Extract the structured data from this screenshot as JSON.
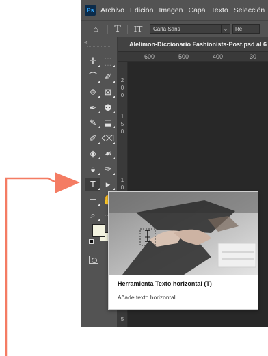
{
  "app": {
    "logo": "Ps"
  },
  "menubar": {
    "items": [
      {
        "label": "Archivo"
      },
      {
        "label": "Edición"
      },
      {
        "label": "Imagen"
      },
      {
        "label": "Capa"
      },
      {
        "label": "Texto"
      },
      {
        "label": "Selección"
      }
    ]
  },
  "options_bar": {
    "home_icon": "home-icon",
    "tool_icon": "T",
    "orientation_icon": "IT",
    "font_family": "Carla Sans",
    "font_style": "Re"
  },
  "document": {
    "tab_title": "Alelimon-Diccionario Fashionista-Post.psd al 6"
  },
  "rulers": {
    "horizontal": [
      "600",
      "500",
      "400",
      "30"
    ],
    "vertical": [
      "2",
      "0",
      "0",
      "1",
      "5",
      "0",
      "1",
      "0",
      "0",
      "5"
    ]
  },
  "toolbox": {
    "collapse": "«",
    "tools": [
      {
        "icon": "move-icon",
        "glyph": "✛"
      },
      {
        "icon": "marquee-icon",
        "glyph": "⬚"
      },
      {
        "icon": "lasso-icon",
        "glyph": "⌒"
      },
      {
        "icon": "quick-selection-icon",
        "glyph": "✐"
      },
      {
        "icon": "crop-icon",
        "glyph": "⯑"
      },
      {
        "icon": "frame-icon",
        "glyph": "⊠"
      },
      {
        "icon": "eyedropper-icon",
        "glyph": "✒"
      },
      {
        "icon": "spot-healing-icon",
        "glyph": "⚉"
      },
      {
        "icon": "brush-icon",
        "glyph": "✎"
      },
      {
        "icon": "clone-stamp-icon",
        "glyph": "⬓"
      },
      {
        "icon": "history-brush-icon",
        "glyph": "✐"
      },
      {
        "icon": "eraser-icon",
        "glyph": "⌫"
      },
      {
        "icon": "paint-bucket-icon",
        "glyph": "◈"
      },
      {
        "icon": "blur-icon",
        "glyph": "☙"
      },
      {
        "icon": "dodge-icon",
        "glyph": "◒"
      },
      {
        "icon": "pen-icon",
        "glyph": "✑"
      },
      {
        "icon": "type-icon",
        "glyph": "T"
      },
      {
        "icon": "path-selection-icon",
        "glyph": "▸"
      },
      {
        "icon": "rectangle-icon",
        "glyph": "▭"
      },
      {
        "icon": "hand-icon",
        "glyph": "✋"
      },
      {
        "icon": "zoom-icon",
        "glyph": "⌕"
      },
      {
        "icon": "more-tools-icon",
        "glyph": "⋯"
      }
    ],
    "foreground_color": "#f3f3e0",
    "background_color": "#f3f3e0"
  },
  "tooltip": {
    "title": "Herramienta Texto horizontal (T)",
    "description": "Añade texto horizontal"
  },
  "callout": {
    "color": "#f47c63"
  }
}
